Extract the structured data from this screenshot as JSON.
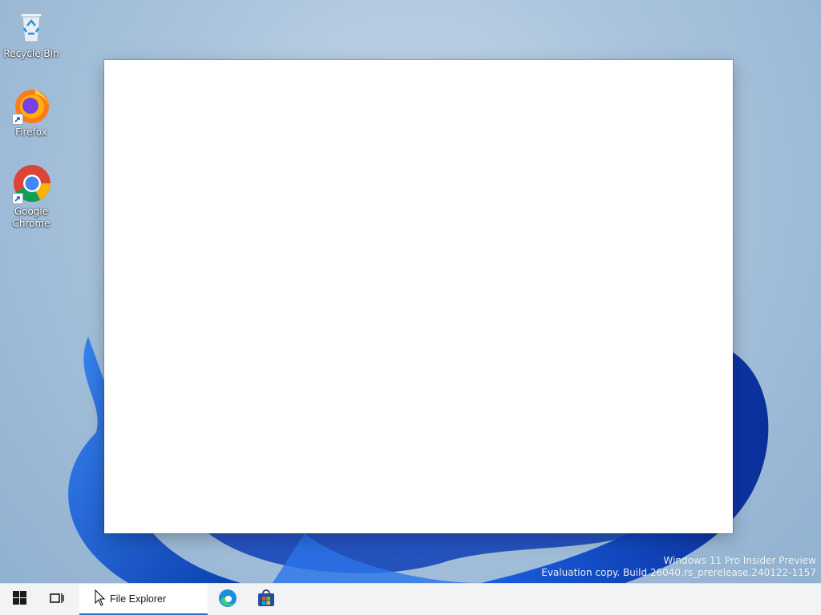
{
  "desktop": {
    "icons": [
      {
        "label": "Recycle Bin",
        "icon": "recycle-bin-icon"
      },
      {
        "label": "Firefox",
        "icon": "firefox-icon"
      },
      {
        "label": "Google Chrome",
        "icon": "chrome-icon"
      }
    ]
  },
  "watermark": {
    "line1": "Windows 11 Pro Insider Preview",
    "line2": "Evaluation copy. Build 26040.rs_prerelease.240122-1157"
  },
  "taskbar": {
    "start_icon": "windows-logo-icon",
    "task_view_icon": "task-view-icon",
    "file_explorer_label": "File Explorer",
    "edge_icon": "edge-icon",
    "store_icon": "store-icon"
  },
  "colors": {
    "wallpaper": "#a9c3dc",
    "bloom": "#1f5fd6",
    "taskbar": "#f2f3f5",
    "accent": "#2f6fb5"
  }
}
